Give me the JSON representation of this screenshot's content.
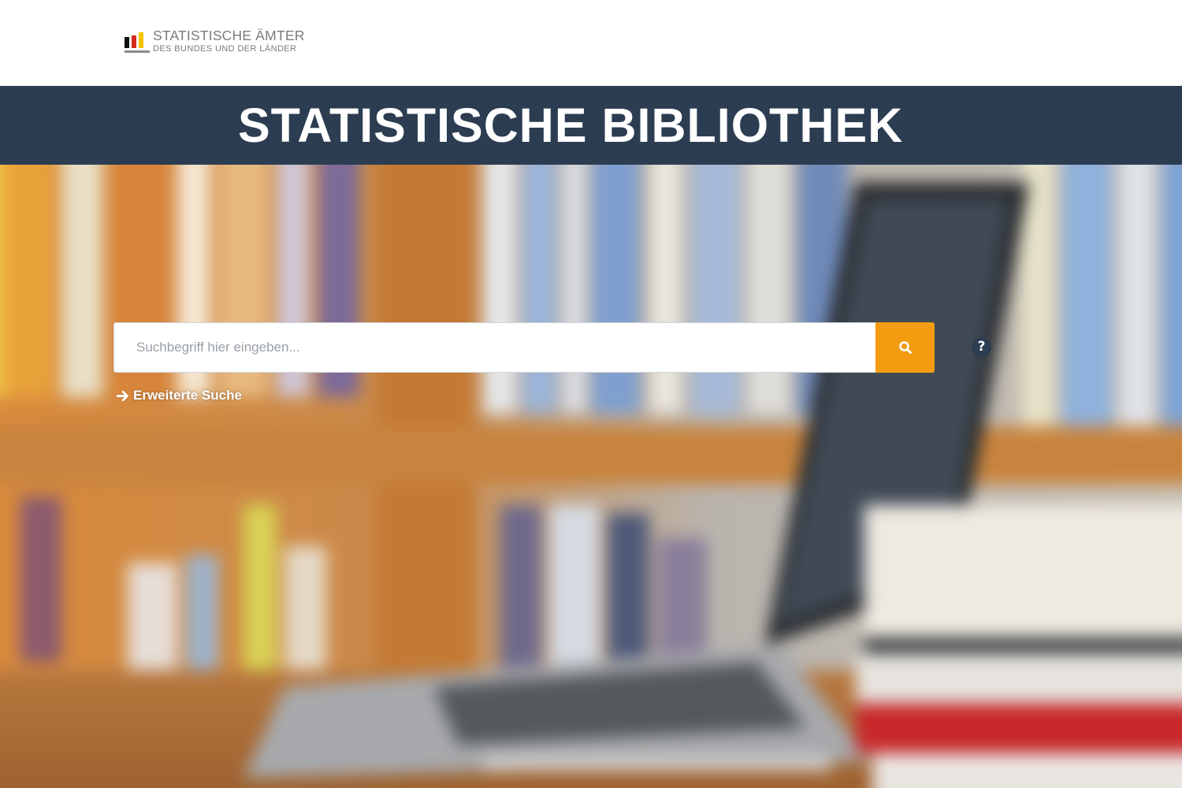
{
  "header": {
    "logo_line1": "STATISTISCHE ÄMTER",
    "logo_line2": "DES BUNDES UND DER LÄNDER",
    "logo_icon": "german-flag-bars-icon"
  },
  "title": "STATISTISCHE BIBLIOTHEK",
  "search": {
    "placeholder": "Suchbegriff hier eingeben...",
    "value": "",
    "button_icon": "search-icon",
    "help_icon": "question-circle-icon"
  },
  "advanced_search": {
    "label": "Erweiterte Suche",
    "icon": "arrow-right-icon"
  },
  "colors": {
    "title_bar": "#2c3d52",
    "search_button": "#f39c12",
    "help_icon": "#2c3d52",
    "logo_text": "#7b7b7b"
  }
}
